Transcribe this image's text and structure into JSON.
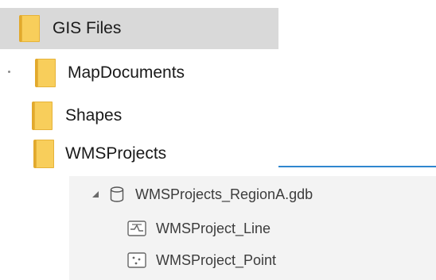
{
  "tree": {
    "root": {
      "label": "GIS Files"
    },
    "folders": [
      {
        "label": "MapDocuments"
      },
      {
        "label": "Shapes"
      },
      {
        "label": "WMSProjects"
      }
    ],
    "gdb": {
      "label": "WMSProjects_RegionA.gdb",
      "expanded": true,
      "items": [
        {
          "label": "WMSProject_Line",
          "icon": "line-feature-class-icon"
        },
        {
          "label": "WMSProject_Point",
          "icon": "point-feature-class-icon"
        }
      ]
    }
  },
  "colors": {
    "folder": "#f8ce5b",
    "selection": "#d9d9d9",
    "accent": "#2f86cf"
  }
}
